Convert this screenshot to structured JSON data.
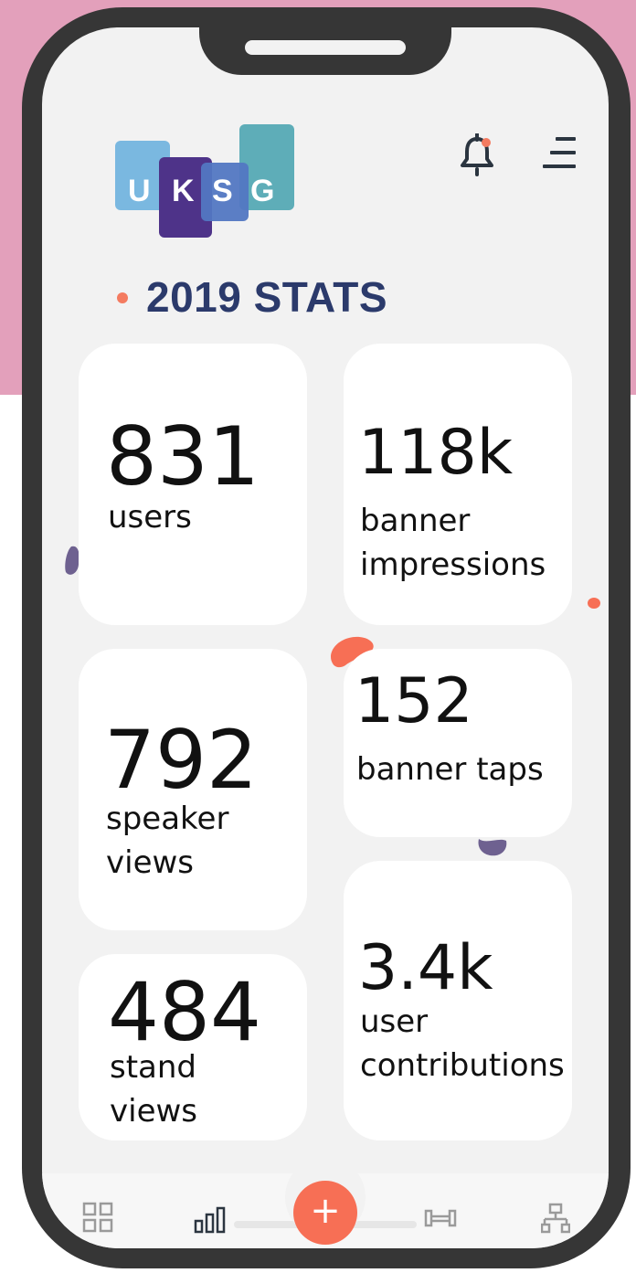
{
  "logo": {
    "letters": [
      "U",
      "K",
      "S",
      "G"
    ]
  },
  "header": {
    "title": "2019 STATS"
  },
  "stats": [
    {
      "value": "831",
      "label": "users"
    },
    {
      "value": "118k",
      "label": "banner\nimpressions"
    },
    {
      "value": "792",
      "label": "speaker\nviews"
    },
    {
      "value": "152",
      "label": "banner taps"
    },
    {
      "value": "484",
      "label": "stand\nviews"
    },
    {
      "value": "3.4k",
      "label": "user\ncontributions"
    }
  ],
  "nav": {
    "fab_label": "+",
    "icons": [
      "dashboard-icon",
      "stats-icon",
      "add-icon",
      "booth-icon",
      "network-icon"
    ]
  },
  "colors": {
    "accent": "#f76f55",
    "title": "#2b3a6b",
    "background_top": "#e3a0bb",
    "phone_frame": "#363636",
    "logo_blue": "#7ab8e0",
    "logo_purple": "#4e3389",
    "logo_mid": "#5277c2",
    "logo_teal": "#5eadb8"
  }
}
